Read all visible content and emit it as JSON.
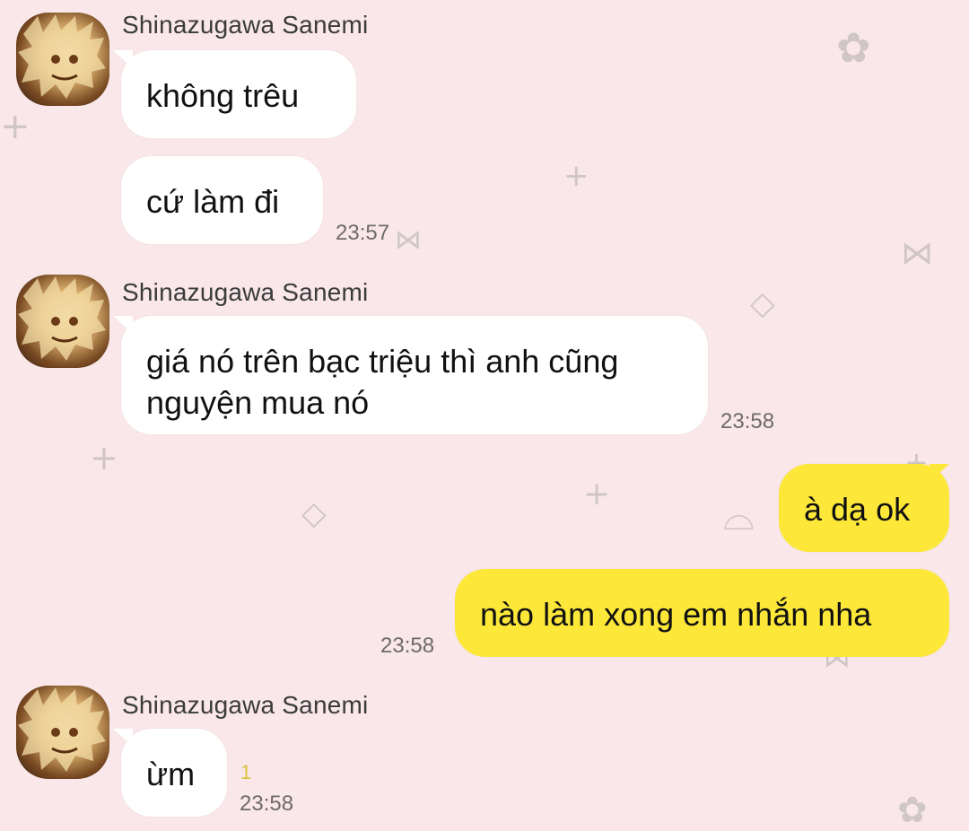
{
  "chat": {
    "sender_name": "Shinazugawa Sanemi",
    "groups": [
      {
        "sender": "Shinazugawa Sanemi",
        "messages": [
          "không trêu",
          "cứ làm đi"
        ],
        "time": "23:57"
      },
      {
        "sender": "Shinazugawa Sanemi",
        "messages": [
          "giá nó trên bạc triệu thì anh cũng nguyện mua nó"
        ],
        "time": "23:58"
      },
      {
        "sender": "me",
        "messages": [
          "à dạ ok",
          "nào làm xong em nhắn nha"
        ],
        "time": "23:58"
      },
      {
        "sender": "Shinazugawa Sanemi",
        "messages": [
          "ừm"
        ],
        "time": "23:58",
        "unread_count": "1"
      }
    ]
  },
  "colors": {
    "background": "#f9e7ea",
    "incoming_bubble": "#ffffff",
    "outgoing_bubble": "#fde83a"
  },
  "icons": [
    "avatar",
    "flower-doodle-icon",
    "bow-doodle-icon",
    "sparkle-doodle-icon",
    "plus-doodle-icon",
    "cat-doodle-icon"
  ]
}
